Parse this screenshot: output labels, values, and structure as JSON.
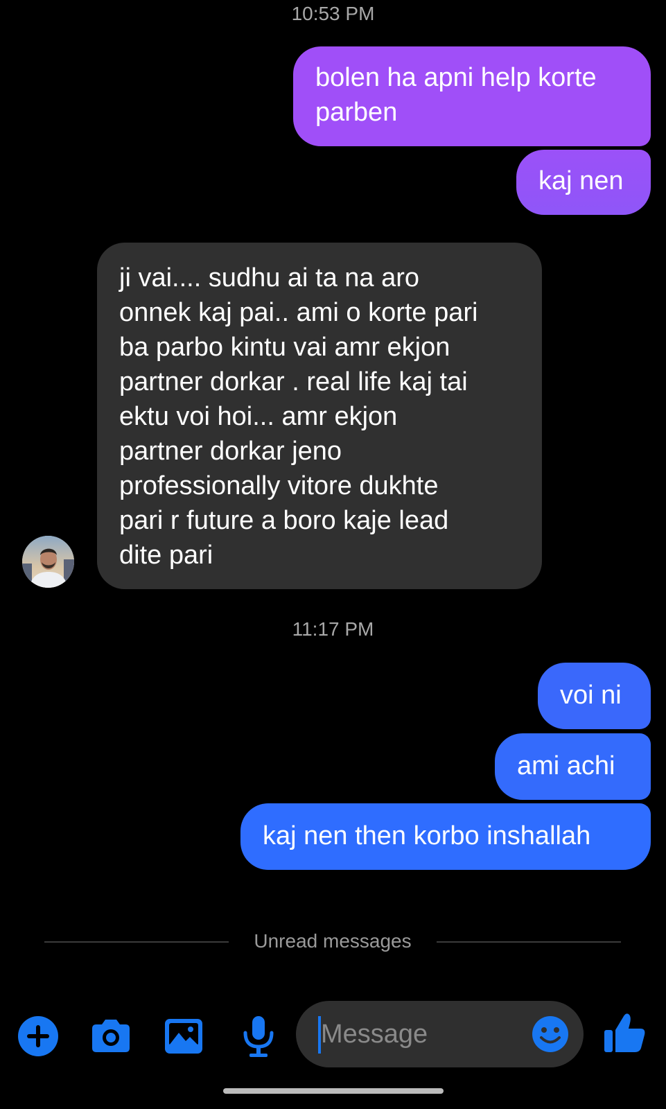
{
  "timestamps": [
    "10:53 PM",
    "11:17 PM"
  ],
  "messages": {
    "sent1": "bolen ha apni help korte\nparben",
    "sent2": "kaj nen",
    "received1": "ji vai.... sudhu ai ta na aro\nonnek kaj pai.. ami o korte pari\nba parbo kintu vai amr ekjon\npartner dorkar . real life kaj tai\nektu voi hoi... amr ekjon\npartner dorkar jeno\nprofessionally vitore dukhte\npari r future a boro kaje lead\ndite pari",
    "sent3": "voi ni",
    "sent4": "ami achi",
    "sent5": "kaj nen then korbo inshallah"
  },
  "divider": {
    "label": "Unread messages"
  },
  "compose": {
    "placeholder": "Message"
  },
  "icons": {
    "add": "add-circle-icon",
    "camera": "camera-icon",
    "gallery": "image-icon",
    "mic": "microphone-icon",
    "emoji": "emoji-icon",
    "like": "thumbs-up-icon"
  },
  "colors": {
    "background": "#000000",
    "sent_purple": "#a151f7",
    "sent_blue": "#2f6bff",
    "received": "#303030",
    "accent": "#1877f2",
    "timestamp": "#a8a8a8"
  }
}
